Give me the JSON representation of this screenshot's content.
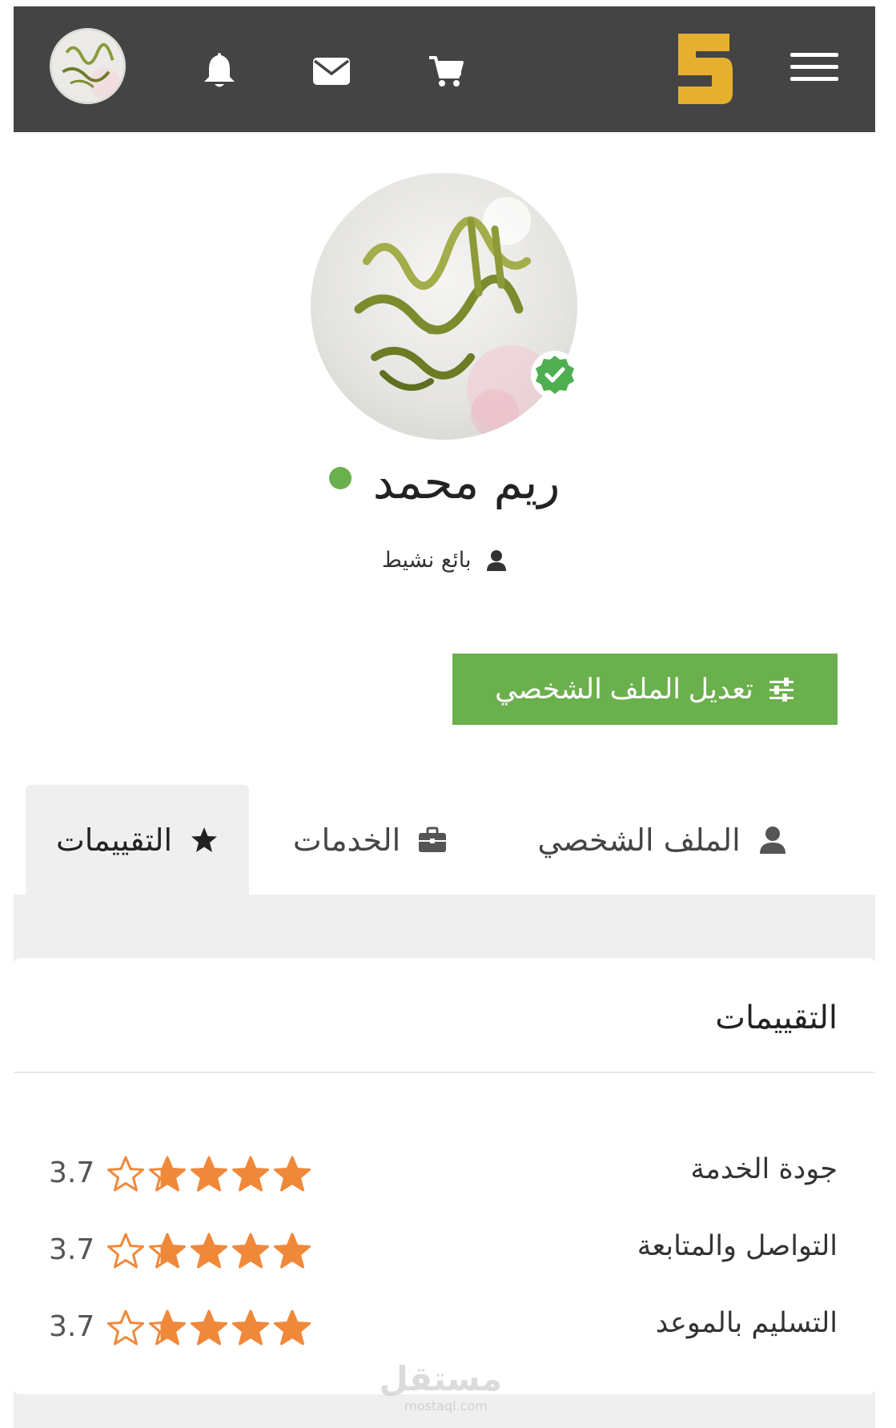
{
  "header": {
    "logo_text": "5",
    "colors": {
      "bar": "#444444",
      "logo": "#e6b02e",
      "icons": "#ffffff"
    },
    "icons": [
      "menu-icon",
      "cart-icon",
      "envelope-icon",
      "bell-icon"
    ]
  },
  "profile": {
    "name": "ريم محمد",
    "role": "بائع نشيط",
    "online": true,
    "verified": true,
    "avatar_calligraphy": "اللهم صل وسلم على نبينا",
    "edit_button_label": "تعديل الملف الشخصي"
  },
  "tabs": [
    {
      "label": "الملف الشخصي",
      "icon": "user-icon",
      "active": false
    },
    {
      "label": "الخدمات",
      "icon": "briefcase-icon",
      "active": false
    },
    {
      "label": "التقييمات",
      "icon": "star-icon",
      "active": true
    }
  ],
  "reviews": {
    "title": "التقييمات",
    "rows": [
      {
        "label": "جودة الخدمة",
        "value": "3.7",
        "stars": 3.7
      },
      {
        "label": "التواصل والمتابعة",
        "value": "3.7",
        "stars": 3.7
      },
      {
        "label": "التسليم بالموعد",
        "value": "3.7",
        "stars": 3.7
      }
    ],
    "star_color": "#f0883a"
  },
  "watermark": {
    "ar": "مستقل",
    "en": "mostaql.com"
  },
  "colors": {
    "accent": "#6ab04c",
    "tab_active_bg": "#efefef",
    "page_bg": "#efefef"
  }
}
